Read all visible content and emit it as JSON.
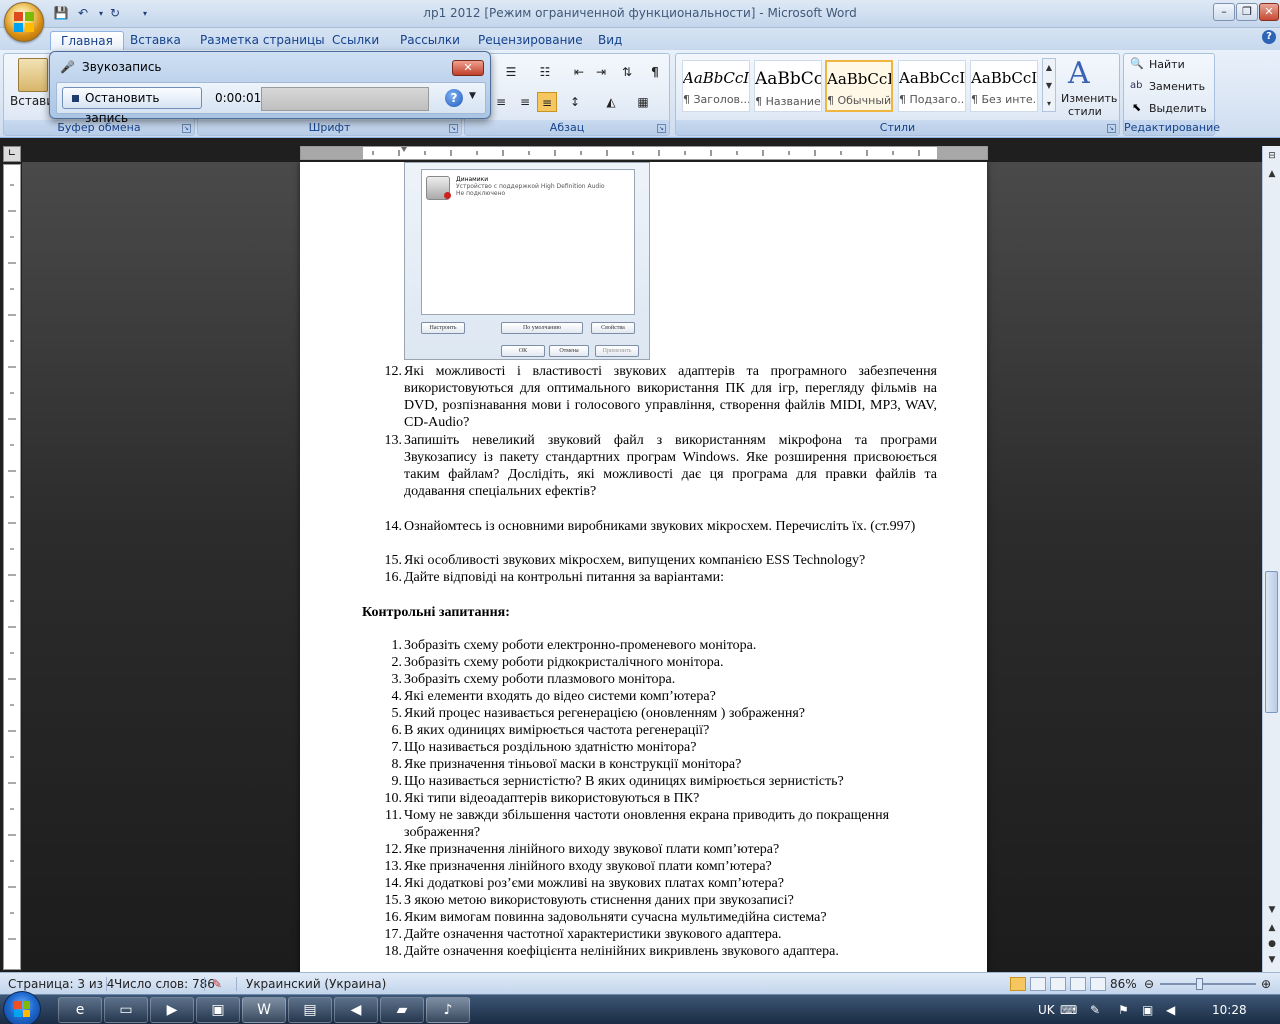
{
  "window_title": "лр1 2012 [Режим ограниченной функциональности] - Microsoft Word",
  "tabs": [
    "Главная",
    "Вставка",
    "Разметка страницы",
    "Ссылки",
    "Рассылки",
    "Рецензирование",
    "Вид"
  ],
  "ribbon": {
    "paste_label": "Вставить",
    "groups": [
      "Буфер обмена",
      "Шрифт",
      "Абзац",
      "Стили",
      "Редактирование"
    ],
    "styles": [
      {
        "sample": "AaBbCcI",
        "name": "¶ Заголов..."
      },
      {
        "sample": "AaBbCc",
        "name": "¶ Название"
      },
      {
        "sample": "AaBbCcI",
        "name": "¶ Обычный"
      },
      {
        "sample": "AaBbCcI",
        "name": "¶ Подзаго..."
      },
      {
        "sample": "AaBbCcI",
        "name": "¶ Без инте..."
      }
    ],
    "change_styles_1": "Изменить",
    "change_styles_2": "стили",
    "find": "Найти",
    "replace": "Заменить",
    "select": "Выделить"
  },
  "recorder": {
    "title": "Звукозапись",
    "stop_button": "Остановить запись",
    "time": "0:00:01"
  },
  "embedded_dialog": {
    "device_name": "Динамики",
    "device_desc": "Устройство с поддержкой High Definition Audio",
    "device_status": "Не подключено",
    "configure": "Настроить",
    "default": "По умолчанию",
    "properties": "Свойства",
    "ok": "ОК",
    "cancel": "Отмена",
    "apply": "Применить"
  },
  "doc": {
    "q12_num": "12.",
    "q12_text": "Які   можливості  і властивості звукових адаптерів та програмного забезпечення використовуються  для   оптимального використання ПК  для ігр,  перегляду фільмів на DVD,  розпізнавання мови і голосового управління,  створення файлів MIDI,   MP3,   WAV,  CD-Audio?",
    "q13_num": "13.",
    "q13_text": "Запишіть невеликий звуковий файл з використанням мікрофона та програми Звукозапису із пакету стандартних програм  Windows. Яке розширення присвоюється таким файлам? Дослідіть, які можливості  дає ця програма для правки файлів та додавання спеціальних ефектів?",
    "q14_num": "14.",
    "q14_text": "Ознайомтесь із основними виробниками звукових мікросхем. Перечисліть їх. (ст.997)",
    "q15_num": "15.",
    "q15_text": "Які особливості звукових мікросхем, випущених компанією ESS Technology?",
    "q16_num": "16.",
    "q16_text": "Дайте відповіді на контрольні питання за варіантами:",
    "heading": "Контрольні запитання:",
    "control_questions": [
      {
        "n": "1.",
        "t": "Зобразіть схему роботи електронно-променевого монітора."
      },
      {
        "n": "2.",
        "t": "Зобразіть схему роботи рідкокристалічного монітора."
      },
      {
        "n": "3.",
        "t": "Зобразіть схему роботи плазмового монітора."
      },
      {
        "n": "4.",
        "t": "Які елементи входять до відео системи комп’ютера?"
      },
      {
        "n": "5.",
        "t": "Який процес називається регенерацією (оновленням ) зображення?"
      },
      {
        "n": "6.",
        "t": "В яких одиницях вимірюється частота регенерації?"
      },
      {
        "n": "7.",
        "t": "Що називається роздільною здатністю монітора?"
      },
      {
        "n": "8.",
        "t": "Яке призначення тіньової маски в конструкції монітора?"
      },
      {
        "n": "9.",
        "t": "Що називається зернистістю? В яких одиницях вимірюється зернистість?"
      },
      {
        "n": "10.",
        "t": "Які типи відеоадаптерів використовуються в ПК?"
      },
      {
        "n": "11.",
        "t": "Чому не завжди збільшення частоти оновлення екрана приводить до покращення зображення?"
      },
      {
        "n": "12.",
        "t": "Яке призначення лінійного виходу звукової плати комп’ютера?"
      },
      {
        "n": "13.",
        "t": "Яке призначення лінійного входу звукової плати комп’ютера?"
      },
      {
        "n": "14.",
        "t": "Які додаткові роз’єми можливі на звукових платах комп’ютера?"
      },
      {
        "n": "15.",
        "t": "З якою метою використовують стиснення даних при звукозаписі?"
      },
      {
        "n": "16.",
        "t": "Яким вимогам повинна задовольняти сучасна мультимедійна система?"
      },
      {
        "n": "17.",
        "t": "Дайте означення частотної характеристики звукового адаптера."
      },
      {
        "n": "18.",
        "t": "Дайте означення коефіцієнта  нелінійних викривлень  звукового адаптера."
      }
    ]
  },
  "status": {
    "page": "Страница: 3 из 4",
    "words": "Число слов: 786",
    "language": "Украинский (Украина)",
    "zoom": "86%"
  },
  "tray": {
    "lang": "UK",
    "time": "10:28"
  },
  "colors": {
    "accent": "#15428b",
    "selected_style": "#f0b53f"
  }
}
